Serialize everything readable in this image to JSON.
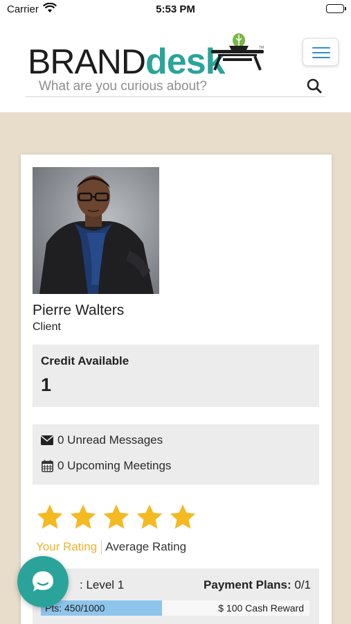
{
  "status_bar": {
    "carrier": "Carrier",
    "time": "5:53 PM"
  },
  "header": {
    "logo_brand": "BRAND",
    "logo_desk": "desk",
    "search_placeholder": "What are you curious about?",
    "brand_color": "#2aa49b"
  },
  "profile": {
    "name": "Pierre Walters",
    "role": "Client"
  },
  "credit": {
    "label": "Credit Available",
    "value": "1"
  },
  "messages": {
    "unread": "0 Unread Messages",
    "meetings": "0 Upcoming Meetings"
  },
  "rating": {
    "stars_filled": 5,
    "stars_total": 5,
    "your_rating_label": "Your Rating",
    "average_rating_label": "Average Rating",
    "star_color": "#f5b921"
  },
  "levels": {
    "level_prefix": "",
    "level_value": ": Level 1",
    "payment_label": "Payment Plans:",
    "payment_value": " 0/1",
    "points_text": "Pts: 450/1000",
    "points_fraction": 0.45,
    "reward_text": "$ 100 Cash Reward"
  },
  "icons": {
    "menu": "hamburger-icon",
    "search": "search-icon",
    "envelope": "envelope-icon",
    "calendar": "calendar-icon",
    "chat": "chat-icon"
  }
}
